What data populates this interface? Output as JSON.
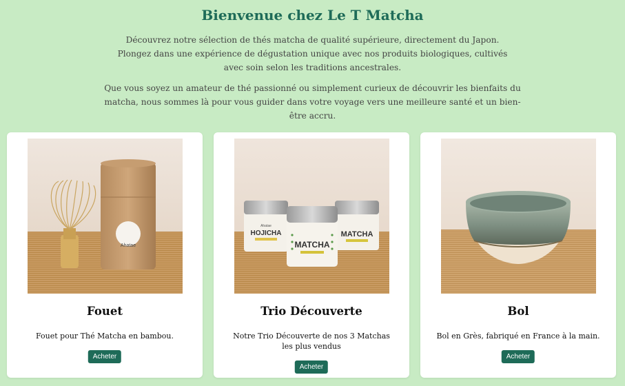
{
  "hero": {
    "title": "Bienvenue chez Le T Matcha",
    "paragraph1": "Découvrez notre sélection de thés matcha de qualité supérieure, directement du Japon. Plongez dans une expérience de dégustation unique avec nos produits biologiques, cultivés avec soin selon les traditions ancestrales.",
    "paragraph2": "Que vous soyez un amateur de thé passionné ou simplement curieux de découvrir les bienfaits du matcha, nous sommes là pour vous guider dans votre voyage vers une meilleure santé et un bien-être accru."
  },
  "products": [
    {
      "title": "Fouet",
      "description": "Fouet pour Thé Matcha en bambou.",
      "button": "Acheter",
      "image_label": "Ahatae"
    },
    {
      "title": "Trio Découverte",
      "description": "Notre Trio Découverte de nos 3 Matchas les plus vendus",
      "button": "Acheter",
      "tin_labels": [
        "Ahatae",
        "HOJICHA",
        "MATCHA",
        "MATCHA"
      ]
    },
    {
      "title": "Bol",
      "description": "Bol en Grès, fabriqué en France à la main.",
      "button": "Acheter"
    }
  ],
  "colors": {
    "background": "#c8ebc4",
    "accent": "#1e6b58",
    "card": "#ffffff"
  }
}
